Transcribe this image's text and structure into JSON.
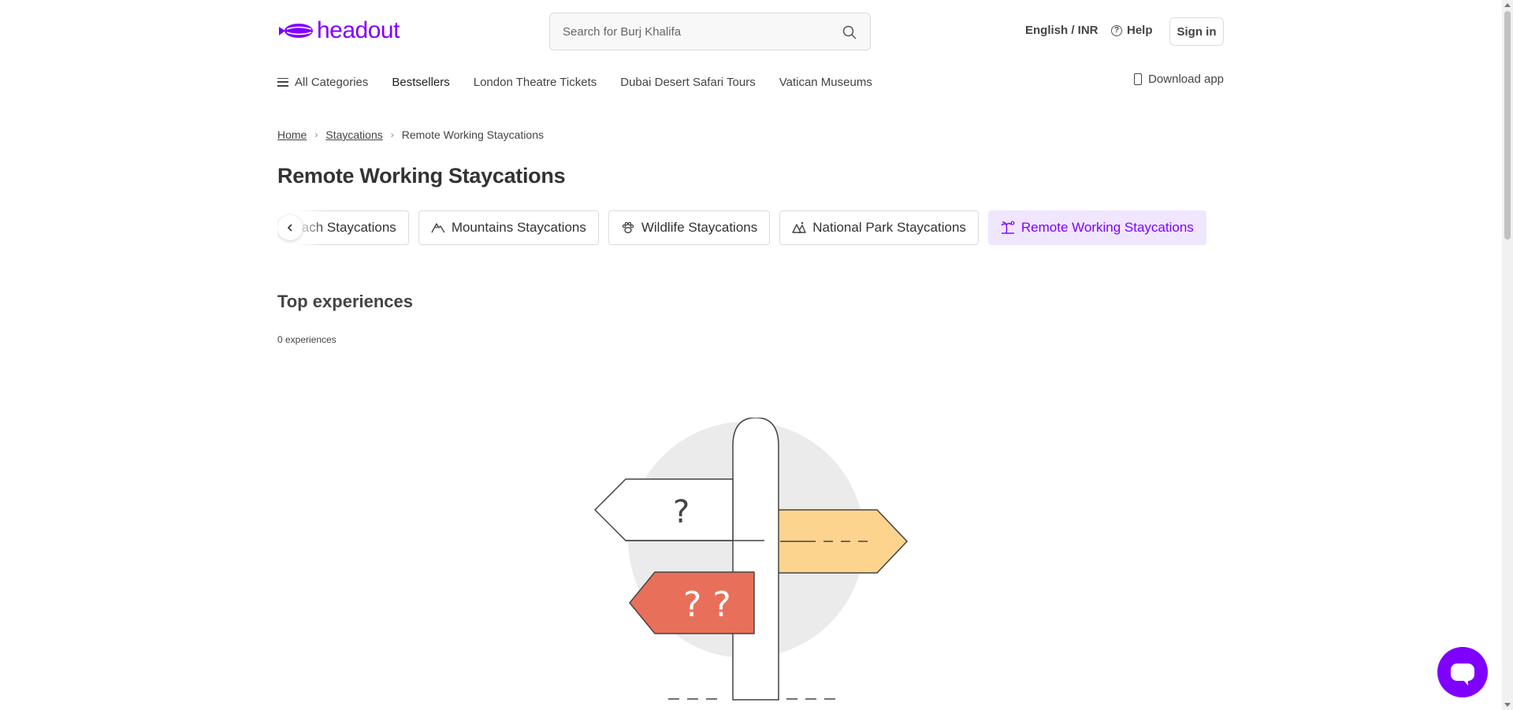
{
  "header": {
    "logo_text": "headout",
    "search_placeholder": "Search for Burj Khalifa",
    "language": "English / INR",
    "help": "Help",
    "sign_in": "Sign in"
  },
  "nav": {
    "all_categories": "All Categories",
    "items": [
      "Bestsellers",
      "London Theatre Tickets",
      "Dubai Desert Safari Tours",
      "Vatican Museums"
    ],
    "download_app": "Download app"
  },
  "breadcrumb": {
    "home": "Home",
    "staycations": "Staycations",
    "current": "Remote Working Staycations"
  },
  "page_title": "Remote Working Staycations",
  "chips": [
    {
      "label": "Beach Staycations",
      "icon": "beach-icon"
    },
    {
      "label": "Mountains Staycations",
      "icon": "mountain-icon"
    },
    {
      "label": "Wildlife Staycations",
      "icon": "paw-icon"
    },
    {
      "label": "National Park Staycations",
      "icon": "national-park-icon"
    },
    {
      "label": "Remote Working Staycations",
      "icon": "palm-tree-icon",
      "active": true
    }
  ],
  "section": {
    "title": "Top experiences",
    "count": "0 experiences"
  },
  "illustration": {
    "sign_top": "?",
    "sign_bottom": "? ?"
  },
  "colors": {
    "brand": "#8000ff",
    "chip_active_bg": "#f0e6ff",
    "sign_yellow": "#fdd48e",
    "sign_red": "#e8705a"
  }
}
